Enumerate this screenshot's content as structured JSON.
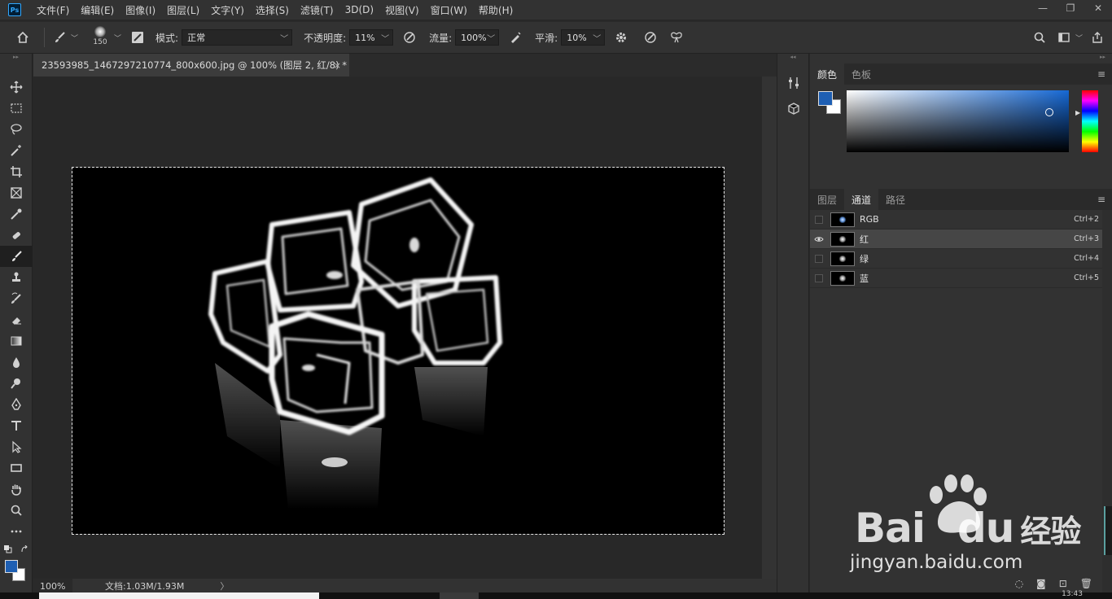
{
  "app": {
    "logo": "Ps"
  },
  "menu": [
    "文件(F)",
    "编辑(E)",
    "图像(I)",
    "图层(L)",
    "文字(Y)",
    "选择(S)",
    "滤镜(T)",
    "3D(D)",
    "视图(V)",
    "窗口(W)",
    "帮助(H)"
  ],
  "window_controls": {
    "minimize": "—",
    "restore": "❐",
    "close": "✕"
  },
  "options": {
    "brush_size": "150",
    "mode_label": "模式:",
    "mode_value": "正常",
    "opacity_label": "不透明度:",
    "opacity_value": "11%",
    "flow_label": "流量:",
    "flow_value": "100%",
    "smoothing_label": "平滑:",
    "smoothing_value": "10%"
  },
  "document": {
    "tab_title": "23593985_1467297210774_800x600.jpg @ 100% (图层 2, 红/8) *",
    "tab_close": "×",
    "zoom": "100%",
    "doc_info": "文档:1.03M/1.93M",
    "more": "〉"
  },
  "color_panel": {
    "tabs": [
      "颜色",
      "色板"
    ],
    "fg_color": "#1e5fb3",
    "bg_color": "#ffffff"
  },
  "channels_panel": {
    "tabs": [
      "图层",
      "通道",
      "路径"
    ],
    "rows": [
      {
        "name": "RGB",
        "shortcut": "Ctrl+2",
        "visible": false
      },
      {
        "name": "红",
        "shortcut": "Ctrl+3",
        "visible": true
      },
      {
        "name": "绿",
        "shortcut": "Ctrl+4",
        "visible": false
      },
      {
        "name": "蓝",
        "shortcut": "Ctrl+5",
        "visible": false
      }
    ]
  },
  "watermark": {
    "brand": "Bai",
    "brand2": "du",
    "cn": "经验",
    "url": "jingyan.baidu.com"
  },
  "taskbar": {
    "clock": "13:43"
  }
}
